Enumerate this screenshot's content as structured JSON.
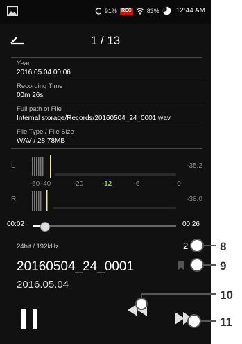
{
  "status_bar": {
    "battery": "91%",
    "rec_badge": "REC",
    "wifi": "83%",
    "time": "12:44 AM"
  },
  "header": {
    "title": "1 / 13"
  },
  "info_rows": [
    {
      "label": "Year",
      "value": "2016.05.04  00:06"
    },
    {
      "label": "Recording Time",
      "value": "00m 26s"
    },
    {
      "label": "Full path of File",
      "value": "Internal storage/Records/20160504_24_0001.wav"
    },
    {
      "label": "File Type / File Size",
      "value": "WAV / 28.78MB"
    }
  ],
  "level_meter": {
    "left_channel": "L",
    "right_channel": "R",
    "left_peak": "-35.2",
    "right_peak": "-38.0",
    "scale": [
      "-60",
      "-40",
      "-20",
      "-12",
      "-6",
      "0"
    ],
    "highlight_tick": "-12"
  },
  "playback": {
    "current_time": "00:02",
    "total_time": "00:26",
    "progress": 0.08
  },
  "track": {
    "bitrate": "24bit / 192kHz",
    "number": "2",
    "file_name": "20160504_24_0001",
    "date": "2016.05.04"
  },
  "callouts": [
    "8",
    "9",
    "10",
    "11"
  ]
}
